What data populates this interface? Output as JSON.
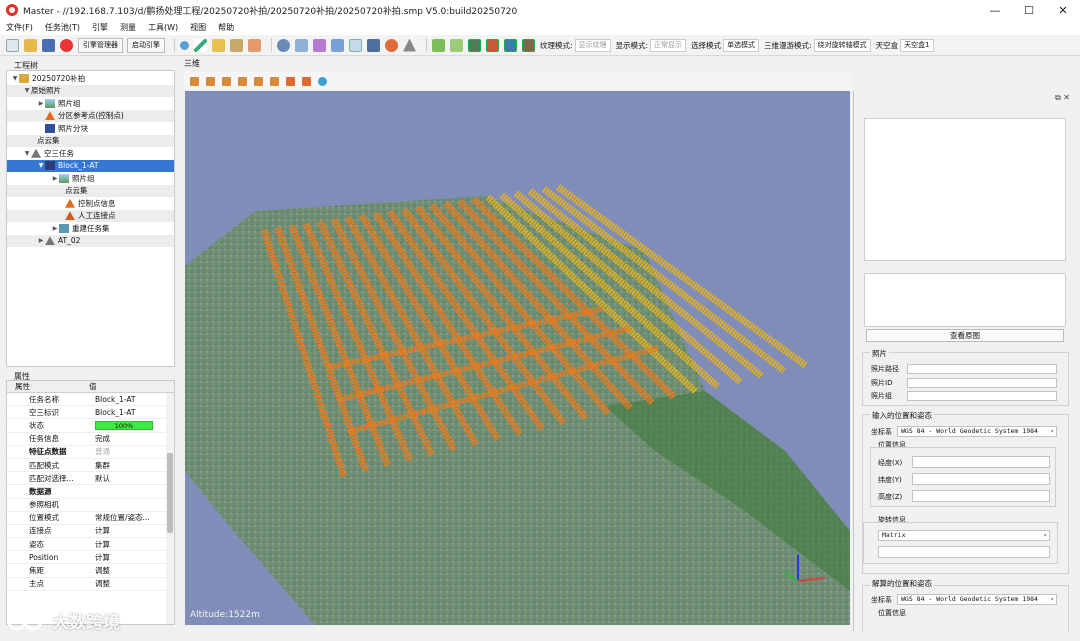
{
  "window": {
    "title": "Master - //192.168.7.103/d/鹏扬处理工程/20250720补拍/20250720补拍/20250720补拍.smp  V5.0:build20250720",
    "controls": [
      "—",
      "☐",
      "✕"
    ]
  },
  "menu": [
    "文件(F)",
    "任务池(T)",
    "引擎",
    "测量",
    "工具(W)",
    "视图",
    "帮助"
  ],
  "toolbar": {
    "engine_manager": "引擎管理器",
    "start_engine": "启动引擎",
    "texture_mode_label": "纹理模式:",
    "texture_mode_value": "显示纹理",
    "display_mode_label": "显示模式:",
    "display_mode_value": "正常显示",
    "select_mode_label": "选择模式",
    "select_mode_value": "单选模式",
    "roam_mode_label": "三维漫游模式:",
    "roam_mode_value": "绕对旋转轴模式",
    "sky_label": "天空盒",
    "sky_value": "天空盒1"
  },
  "project_tree": {
    "caption": "工程树",
    "items": [
      {
        "label": "20250720补拍",
        "depth": 0,
        "expanded": true,
        "icon": "folder-icon"
      },
      {
        "label": "原始照片",
        "depth": 1,
        "expanded": true,
        "icon": "none"
      },
      {
        "label": "照片组",
        "depth": 2,
        "expanded": false,
        "icon": "photo-group-icon"
      },
      {
        "label": "分区参考点(控制点)",
        "depth": 2,
        "expanded": null,
        "icon": "control-point-icon"
      },
      {
        "label": "照片分块",
        "depth": 2,
        "expanded": null,
        "icon": "photo-block-icon"
      },
      {
        "label": "点云集",
        "depth": 1,
        "expanded": null,
        "icon": "none"
      },
      {
        "label": "空三任务",
        "depth": 1,
        "expanded": true,
        "icon": "aerial-triangulation-icon"
      },
      {
        "label": "Block_1-AT",
        "depth": 2,
        "expanded": true,
        "icon": "block-icon",
        "selected": true
      },
      {
        "label": "照片组",
        "depth": 3,
        "expanded": false,
        "icon": "photo-group-icon"
      },
      {
        "label": "点云集",
        "depth": 3,
        "expanded": null,
        "icon": "none"
      },
      {
        "label": "控制点信息",
        "depth": 3,
        "expanded": null,
        "icon": "control-point-icon"
      },
      {
        "label": "人工连接点",
        "depth": 3,
        "expanded": null,
        "icon": "tie-point-icon"
      },
      {
        "label": "重建任务集",
        "depth": 3,
        "expanded": false,
        "icon": "reconstruction-icon"
      },
      {
        "label": "AT_02",
        "depth": 2,
        "expanded": false,
        "icon": "aerial-triangulation-icon"
      }
    ]
  },
  "properties": {
    "caption": "属性",
    "header_key": "属性",
    "header_value": "值",
    "rows": [
      {
        "key": "任务名称",
        "value": "Block_1-AT"
      },
      {
        "key": "空三标识",
        "value": "Block_1-AT"
      },
      {
        "key": "状态",
        "value": "100%",
        "progress": 1.0
      },
      {
        "key": "任务信息",
        "value": "完成"
      },
      {
        "key": "特征点数据",
        "value": "普通",
        "bold": true,
        "dropdown": true
      },
      {
        "key": "匹配模式",
        "value": "集群"
      },
      {
        "key": "匹配对选择...",
        "value": "默认"
      },
      {
        "key": "数据源",
        "value": "",
        "bold": true
      },
      {
        "key": "参照相机",
        "value": ""
      },
      {
        "key": "位置模式",
        "value": "常规位置/姿态..."
      },
      {
        "key": "连接点",
        "value": "计算"
      },
      {
        "key": "姿态",
        "value": "计算"
      },
      {
        "key": "Position",
        "value": "计算"
      },
      {
        "key": "焦距",
        "value": "调整"
      },
      {
        "key": "主点",
        "value": "调整"
      }
    ]
  },
  "viewport": {
    "tab_label": "三维",
    "altitude_text": "Altitude:1522m"
  },
  "right_panel": {
    "view_original_button": "查看原图",
    "photo_group": {
      "title": "照片",
      "fields": [
        "照片路径",
        "照片ID",
        "照片组"
      ]
    },
    "input_pose_group": {
      "title": "输入的位置和姿态",
      "crs_label": "坐标系",
      "crs_value": "WGS 84 - World Geodetic System 1984",
      "position_title": "位置信息",
      "position_fields": [
        "经度(X)",
        "纬度(Y)",
        "高度(Z)"
      ],
      "rotation_title": "旋转信息",
      "rotation_value": "Matrix"
    },
    "solved_pose_group": {
      "title": "解算的位置和姿态",
      "crs_label": "坐标系",
      "crs_value": "WGS 84 - World Geodetic System 1984",
      "position_title": "位置信息"
    }
  },
  "watermark": {
    "text": "大数跨境"
  },
  "colors": {
    "selection": "#3478d4",
    "viewport_bg": "#808db8",
    "flight_strip": "#f07a1a",
    "progress": "#3fe83f"
  }
}
